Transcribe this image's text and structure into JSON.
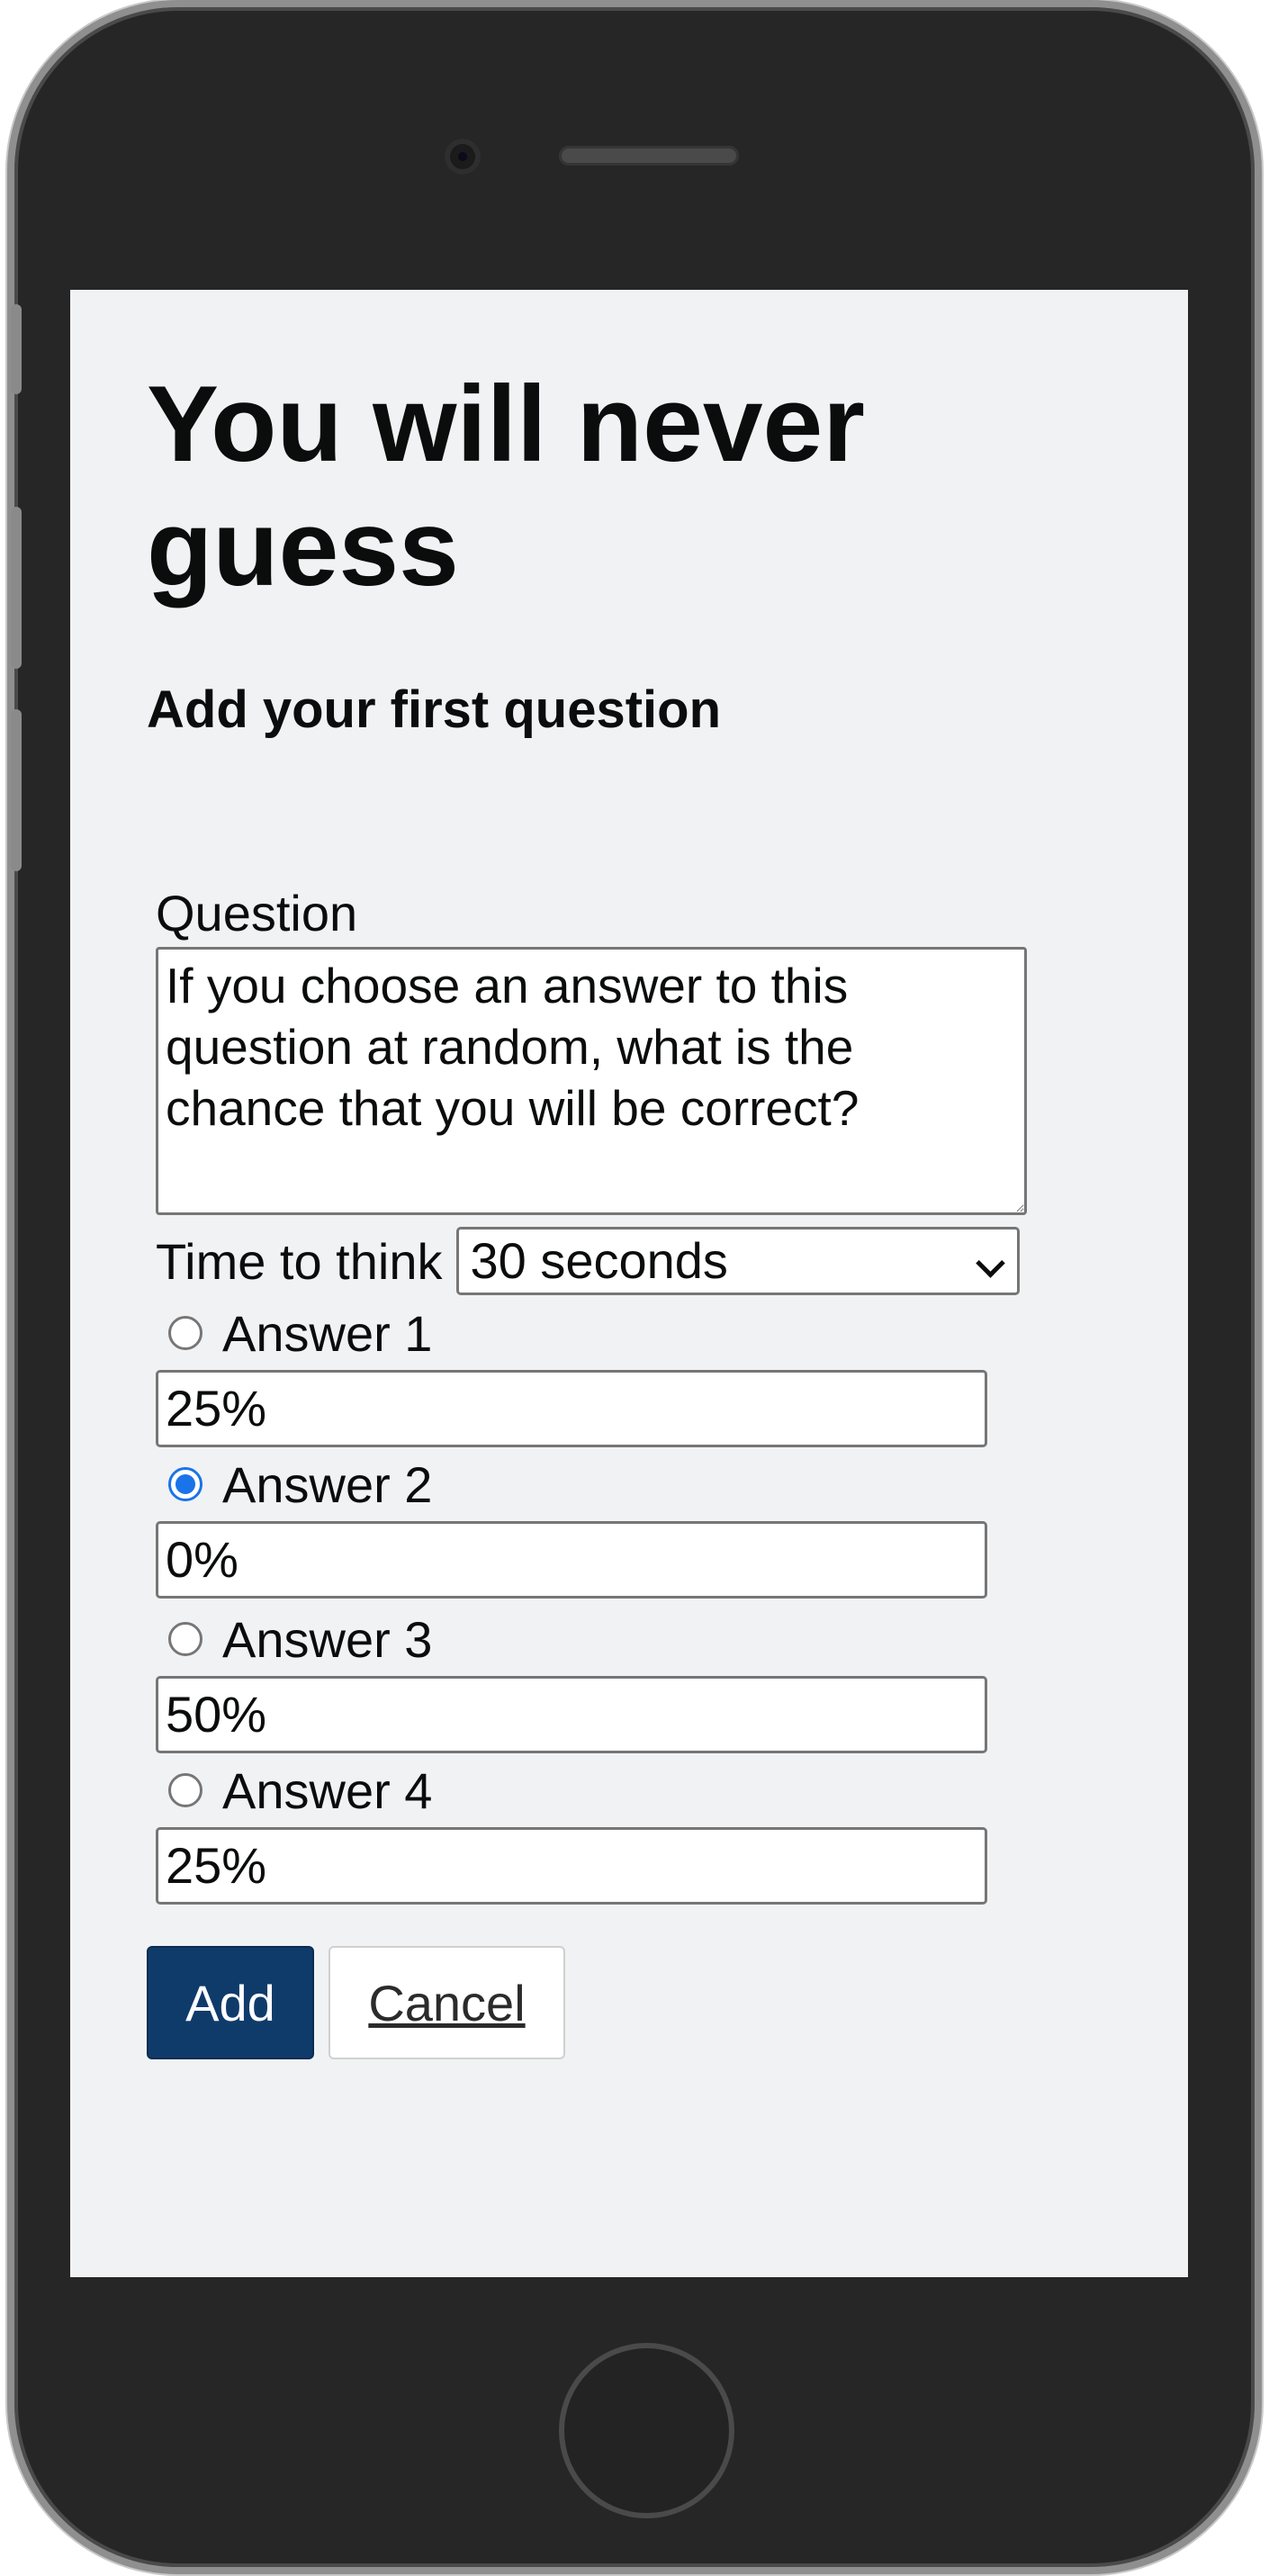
{
  "page": {
    "title": "You will never guess",
    "subtitle": "Add your first question"
  },
  "form": {
    "question_label": "Question",
    "question_value": "If you choose an answer to this question at random, what is the chance that you will be correct?",
    "time_label": "Time to think",
    "time_selected": "30 seconds",
    "answers": [
      {
        "label": "Answer 1",
        "value": "25%",
        "selected": false
      },
      {
        "label": "Answer 2",
        "value": "0%",
        "selected": true
      },
      {
        "label": "Answer 3",
        "value": "50%",
        "selected": false
      },
      {
        "label": "Answer 4",
        "value": "25%",
        "selected": false
      }
    ],
    "add_label": "Add",
    "cancel_label": "Cancel"
  },
  "colors": {
    "primary_button": "#0f3b6b",
    "radio_checked": "#1a73e8",
    "screen_background": "#f1f2f4"
  }
}
